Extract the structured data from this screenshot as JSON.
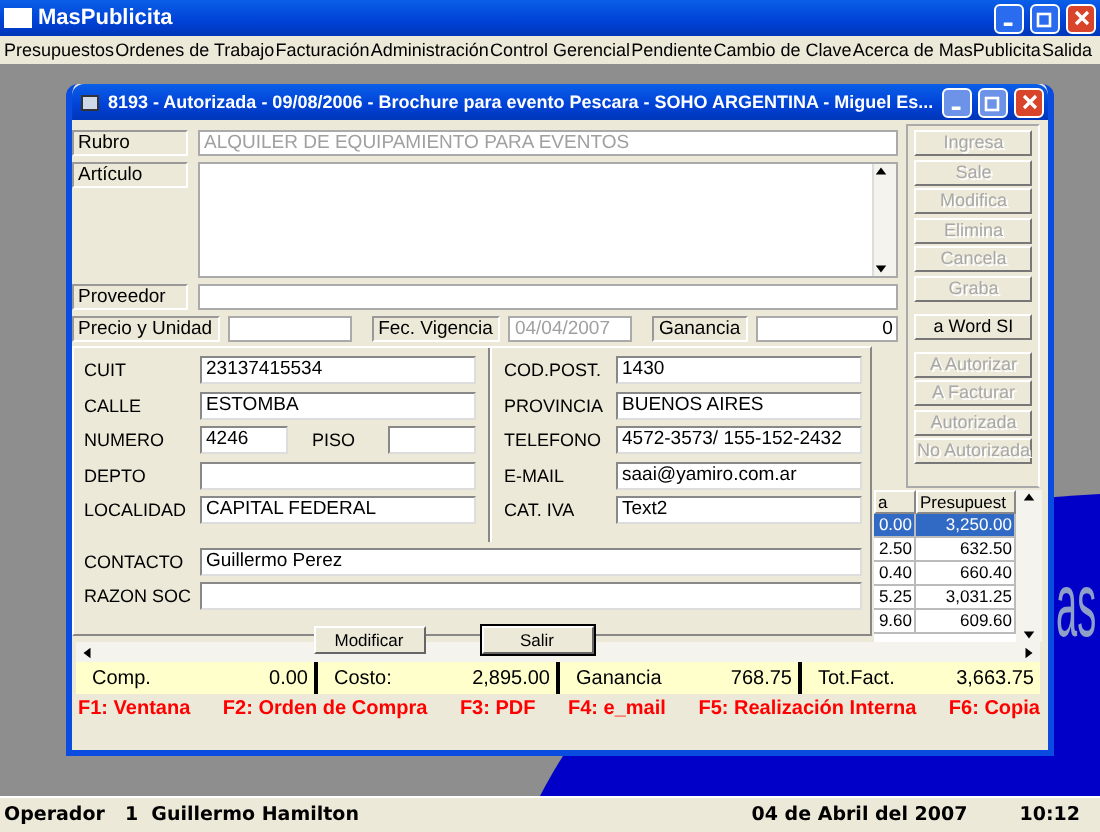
{
  "app": {
    "title": "MasPublicita"
  },
  "menu": [
    "Presupuestos",
    "Ordenes de Trabajo",
    "Facturación",
    "Administración",
    "Control Gerencial",
    "Pendiente",
    "Cambio de Clave",
    "Acerca de MasPublicita",
    "Salida"
  ],
  "background_logo": {
    "text": "as"
  },
  "window": {
    "title": "8193 - Autorizada  - 09/08/2006 - Brochure para evento Pescara - SOHO ARGENTINA - Miguel Es..."
  },
  "form": {
    "rows": [
      {
        "kind": "line",
        "label": "Rubro",
        "value": "ALQUILER DE EQUIPAMIENTO PARA EVENTOS",
        "disabled": true
      },
      {
        "kind": "memo",
        "label": "Artículo"
      },
      {
        "kind": "line",
        "label": "Proveedor"
      }
    ],
    "price_row": [
      {
        "label": "Precio y Unidad"
      },
      {
        "label": "Fec. Vigencia",
        "value": "04/04/2007",
        "disabled": true
      },
      {
        "label": "Ganancia",
        "value": "0",
        "disabled": false
      }
    ]
  },
  "action_groups": [
    [
      {
        "label": "Ingresa",
        "disabled": true
      },
      {
        "label": "Sale",
        "disabled": true
      },
      {
        "label": "Modifica",
        "disabled": true
      },
      {
        "label": "Elimina",
        "disabled": true
      },
      {
        "label": "Cancela",
        "disabled": true
      },
      {
        "label": "Graba",
        "disabled": true
      }
    ],
    [
      {
        "label": "a Word SI",
        "disabled": false
      }
    ],
    [
      {
        "label": "A  Autorizar",
        "disabled": true
      },
      {
        "label": "A Facturar",
        "disabled": true
      },
      {
        "label": "Autorizada",
        "disabled": true
      },
      {
        "label": "No  Autorizada",
        "disabled": true
      }
    ]
  ],
  "table": {
    "columns": [
      "a",
      "Presupuest"
    ],
    "rows": [
      {
        "cells": [
          "0.00",
          "3,250.00"
        ],
        "selected": true
      },
      {
        "cells": [
          "2.50",
          "632.50"
        ],
        "selected": false
      },
      {
        "cells": [
          "0.40",
          "660.40"
        ],
        "selected": false
      },
      {
        "cells": [
          "5.25",
          "3,031.25"
        ],
        "selected": false
      },
      {
        "cells": [
          "9.60",
          "609.60"
        ],
        "selected": false
      }
    ]
  },
  "totals": [
    {
      "label": "Comp.",
      "value": "0.00"
    },
    {
      "label": "Costo:",
      "value": "2,895.00"
    },
    {
      "label": "Ganancia",
      "value": "768.75"
    },
    {
      "label": "Tot.Fact.",
      "value": "3,663.75"
    }
  ],
  "shortcuts": [
    "F1: Ventana",
    "F2: Orden de Compra",
    "F3: PDF",
    "F4: e_mail",
    "F5: Realización Interna",
    "F6: Copia"
  ],
  "client_dialog": {
    "left_rows": [
      [
        {
          "label": "CUIT",
          "value": "23137415534"
        }
      ],
      [
        {
          "label": "CALLE",
          "value": "ESTOMBA"
        }
      ],
      [
        {
          "label": "NUMERO",
          "value": "4246"
        },
        {
          "label": "PISO"
        }
      ],
      [
        {
          "label": "DEPTO"
        }
      ],
      [
        {
          "label": "LOCALIDAD",
          "value": "CAPITAL FEDERAL"
        }
      ]
    ],
    "right_rows": [
      {
        "label": "COD.POST.",
        "value": "1430"
      },
      {
        "label": "PROVINCIA",
        "value": "BUENOS AIRES"
      },
      {
        "label": "TELEFONO",
        "value": "4572-3573/ 155-152-2432"
      },
      {
        "label": "E-MAIL",
        "value": "saai@yamiro.com.ar"
      },
      {
        "label": "CAT. IVA",
        "value": "Text2"
      }
    ],
    "wide_rows": [
      {
        "label": "CONTACTO",
        "value": "Guillermo Perez"
      },
      {
        "label": "RAZON SOC"
      }
    ],
    "buttons": [
      {
        "label": "Modificar",
        "default": false
      },
      {
        "label": "Salir",
        "default": true
      }
    ]
  },
  "status_bar": {
    "user_label": "Operador",
    "user": "1  Guillermo Hamilton",
    "date": "04 de Abril del 2007",
    "time": "10:12"
  }
}
